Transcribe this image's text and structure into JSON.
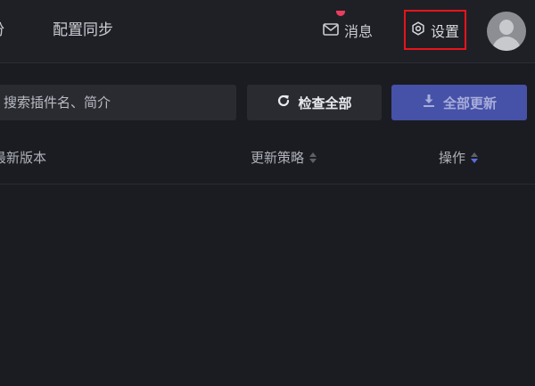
{
  "nav": {
    "tabs": [
      {
        "label": "份"
      },
      {
        "label": "配置同步"
      }
    ],
    "messages_label": "消息",
    "settings_label": "设置",
    "icons": {
      "messages": "mail-icon",
      "settings": "gear-icon",
      "avatar": "user-avatar"
    }
  },
  "toolbar": {
    "search_placeholder": "搜索插件名、简介",
    "check_all_label": "检查全部",
    "update_all_label": "全部更新",
    "icons": {
      "check": "refresh-icon",
      "update": "download-icon"
    }
  },
  "table": {
    "columns": [
      {
        "label": "最新版本"
      },
      {
        "label": "更新策略"
      },
      {
        "label": "操作"
      }
    ]
  },
  "colors": {
    "background": "#1b1c21",
    "primary_button": "#4651a8",
    "highlight_border": "#e8141b",
    "notification_dot": "#ec3c5e",
    "sort_active": "#5a6de0"
  }
}
